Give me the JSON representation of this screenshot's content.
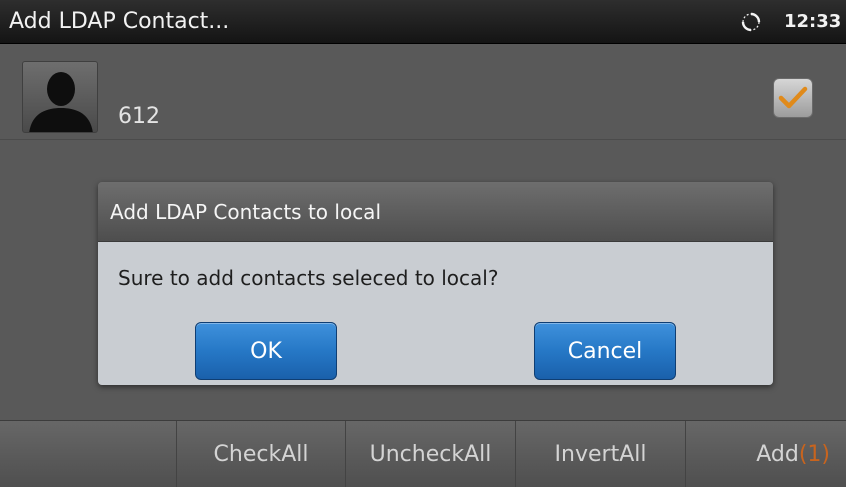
{
  "header": {
    "title": "Add LDAP Contact...",
    "time": "12:33",
    "status_icon": "sync-icon"
  },
  "contact": {
    "number": "612",
    "avatar_icon": "person-silhouette-icon",
    "checked": true
  },
  "dialog": {
    "title": "Add LDAP Contacts to local",
    "message": "Sure to add contacts seleced to local?",
    "ok_label": "OK",
    "cancel_label": "Cancel"
  },
  "softkeys": {
    "blank": "",
    "check_all": "CheckAll",
    "uncheck_all": "UncheckAll",
    "invert_all": "InvertAll",
    "add_label": "Add",
    "add_count": "(1)"
  },
  "colors": {
    "button_blue": "#2678c6",
    "count_orange": "#c8641e",
    "check_orange": "#e08a1a"
  }
}
